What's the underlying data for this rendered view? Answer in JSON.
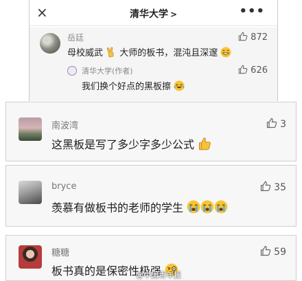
{
  "nav": {
    "close_icon": "×",
    "title": "清华大学",
    "chevron": ">",
    "more_icon": "•••"
  },
  "main_comment": {
    "username": "岳廷",
    "text_before": "母校威武",
    "text_after": "大师的板书，混沌且深邃",
    "likes": "872",
    "reply": {
      "username": "清华大学(作者)",
      "text": "我们换个好点的黑板擦",
      "likes": "626"
    }
  },
  "comments": [
    {
      "username": "南波湾",
      "text": "这黑板是写了多少字多少公式",
      "likes": "3"
    },
    {
      "username": "bryce",
      "text": "羡慕有做板书的老师的学生",
      "likes": "35"
    },
    {
      "username": "糖糖",
      "text": "板书真的是保密性极强",
      "likes": "59"
    }
  ],
  "watermark": "@中国青年报",
  "icons": [
    "close-icon",
    "more-icon",
    "thumb-up-icon",
    "victory-hand-emoji",
    "grin-emoji",
    "laugh-cry-emoji",
    "thumbs-up-emoji",
    "crying-emoji",
    "monocle-emoji"
  ],
  "colors": {
    "username": "#888888",
    "card_bg": "#f7f7f7",
    "main_bg": "#f5f5f5"
  }
}
